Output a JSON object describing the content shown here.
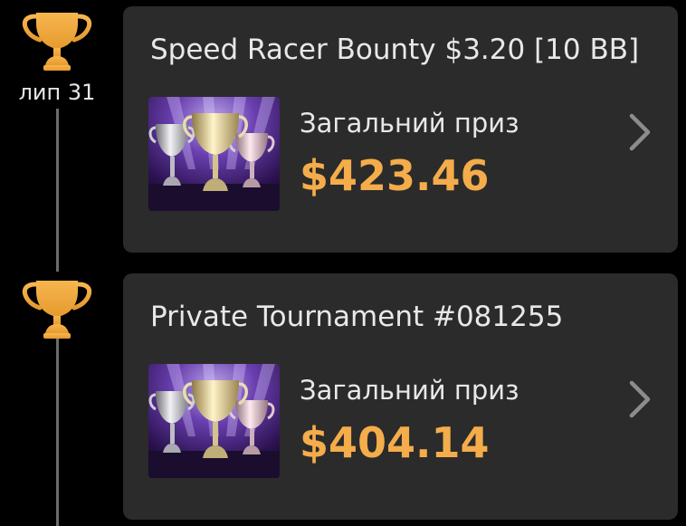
{
  "colors": {
    "background": "#000000",
    "card": "#2b2b2b",
    "accent_gold": "#f4ad4a",
    "timeline": "#6b6b6b"
  },
  "timeline": {
    "date": "лип 31"
  },
  "tournaments": [
    {
      "title": "Speed Racer Bounty $3.20 [10 BB]",
      "prize_label": "Загальний приз",
      "prize_amount": "$423.46",
      "icon": "trophy-icon",
      "thumbnail": "trophies-thumbnail",
      "chevron": "chevron-right-icon"
    },
    {
      "title": "Private Tournament #081255",
      "prize_label": "Загальний приз",
      "prize_amount": "$404.14",
      "icon": "trophy-icon",
      "thumbnail": "trophies-thumbnail",
      "chevron": "chevron-right-icon"
    }
  ]
}
